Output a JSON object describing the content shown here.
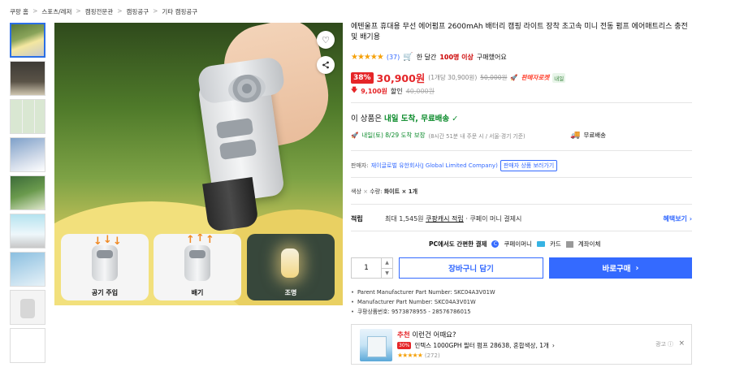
{
  "breadcrumb": [
    "쿠팡 홈",
    "스포츠/레저",
    "캠핑전문관",
    "캠핑공구",
    "기타 캠핑공구"
  ],
  "breadcrumb_separator": ">",
  "product": {
    "title": "에텐울프 휴대용 무선 에어펌프 2600mAh 배터리 캠핑 라이트 장착 초고속 미니 전동 펌프 에어매트리스 충전 및 배기용",
    "rating_stars": "★★★★★",
    "review_count": "(37)",
    "purchase_prefix": "한 달간",
    "purchase_highlight": "100명 이상",
    "purchase_suffix": "구매했어요",
    "discount_rate": "38%",
    "price": "30,900원",
    "unit_price": "(1개당 30,900원)",
    "original_price": "50,000원",
    "wow_badge": "🚀",
    "rocket_label": "판매자로켓",
    "instant_badge": "내일",
    "coupon_arrow": "🡇",
    "coupon_amount": "9,100원",
    "coupon_label": "할인",
    "coupon_strike": "40,000원"
  },
  "delivery": {
    "headline_prefix": "이 상품은",
    "headline_green": "내일 도착, 무료배송",
    "headline_check": "✓",
    "detail_green": "내일(토) 8/29 도착 보장",
    "detail_gray": "(8시간 51분 내 주문 시 / 서울·경기 기준)",
    "free_ship": "무료배송"
  },
  "seller": {
    "label": "판매자:",
    "name": "재이글로벌 유한회사(J Global Limited Company)",
    "button": "판매자 상품 보러가기"
  },
  "option": {
    "color_label": "색상",
    "sep1": "×",
    "qty_label": "수량:",
    "value": "화이트 × 1개"
  },
  "reward": {
    "label": "적립",
    "text_prefix": "최대 1,545원",
    "cash": "쿠팡캐시 적립",
    "text_suffix": "· 쿠페이 머니 결제시",
    "more": "혜택보기 ›"
  },
  "payment": {
    "prefix": "PC에서도 간편한 결제",
    "money": "쿠페이머니",
    "card": "카드",
    "bank": "계좌이체"
  },
  "actions": {
    "quantity": "1",
    "cart": "장바구니 담기",
    "buy": "바로구매",
    "buy_arrow": "›"
  },
  "specs": [
    "Parent Manufacturer Part Number: SKC04A3V01W",
    "Manufacturer Part Number: SKC04A3V01W",
    "쿠팡상품번호: 9573878955 - 28576786015"
  ],
  "image": {
    "modes": [
      "공기 주입",
      "배기",
      "조명"
    ]
  },
  "recommend": {
    "head_red": "추천",
    "head_text": "이런건 어때요?",
    "discount": "30%",
    "title": "인텍스 1000GPH 필터 펌프 28638, 혼합색상, 1개",
    "arrow": "›",
    "stars": "★★★★★",
    "count": "(272)",
    "ad": "광고",
    "ad_info": "ⓘ",
    "close": "×"
  },
  "icons": {
    "heart": "♡",
    "share": "⋖"
  },
  "colors": {
    "accent_blue": "#346aff",
    "price_red": "#e52528",
    "delivery_green": "#0a8a2a",
    "star_orange": "#f5a10a"
  }
}
